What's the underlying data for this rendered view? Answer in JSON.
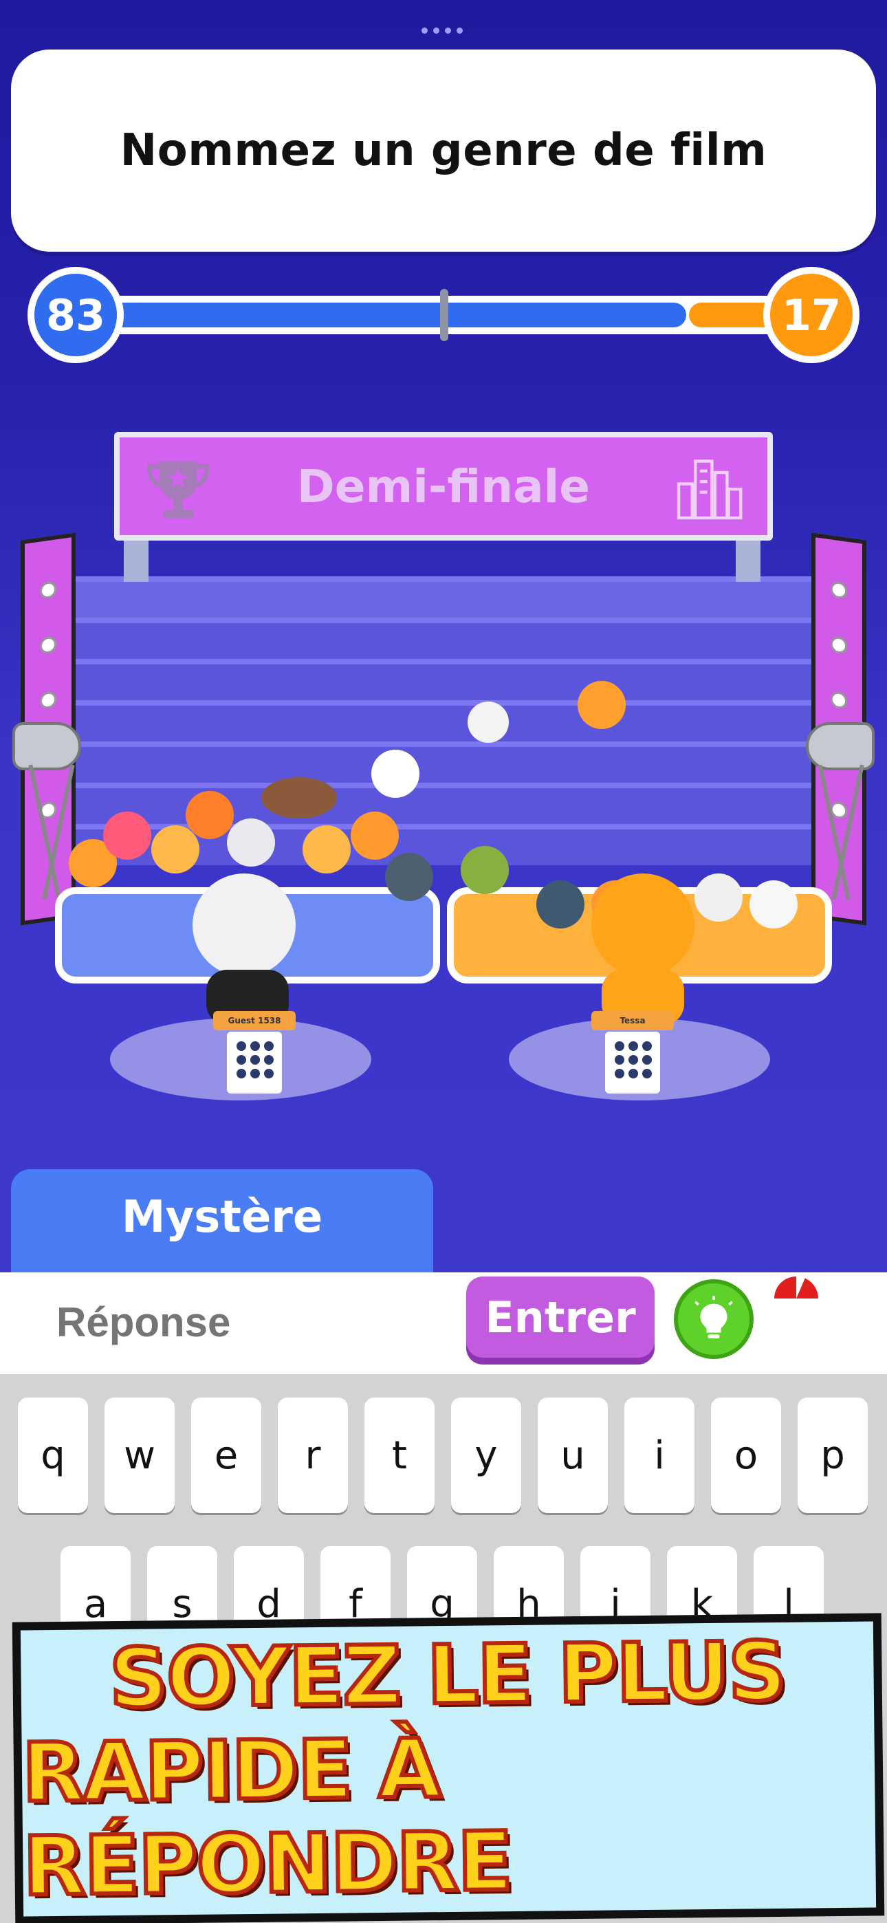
{
  "question": {
    "text": "Nommez un genre de film"
  },
  "score": {
    "left": "83",
    "right": "17",
    "left_color": "#2f6cf0",
    "right_color": "#ff9a0f",
    "left_fraction": 0.83
  },
  "banner": {
    "title": "Demi-finale",
    "left_icon": "trophy-icon",
    "right_icon": "city-icon"
  },
  "podiums": {
    "left_label": "Guest 1538",
    "right_label": "Tessa"
  },
  "category": {
    "label": "Mystère"
  },
  "answer": {
    "placeholder": "Réponse",
    "enter_label": "Entrer",
    "hint_icon": "lightbulb-icon",
    "timer_icon": "timer-icon"
  },
  "keyboard": {
    "row1": [
      "q",
      "w",
      "e",
      "r",
      "t",
      "y",
      "u",
      "i",
      "o",
      "p"
    ],
    "row2": [
      "a",
      "s",
      "d",
      "f",
      "g",
      "h",
      "j",
      "k",
      "l"
    ]
  },
  "promo": {
    "line1": "Soyez le plus",
    "line2": "rapide à répondre"
  }
}
